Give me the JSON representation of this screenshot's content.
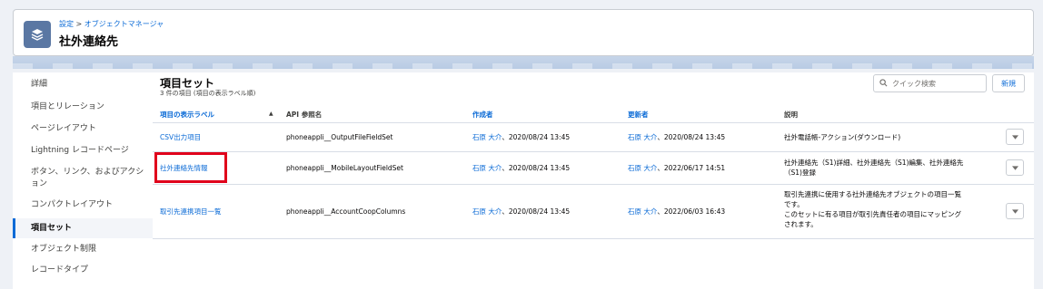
{
  "header": {
    "breadcrumb_setup": "設定",
    "breadcrumb_sep": " > ",
    "breadcrumb_object_manager": "オブジェクトマネージャ",
    "title": "社外連絡先"
  },
  "sidebar": {
    "items": [
      {
        "label": "詳細",
        "active": false
      },
      {
        "label": "項目とリレーション",
        "active": false
      },
      {
        "label": "ページレイアウト",
        "active": false
      },
      {
        "label": "Lightning レコードページ",
        "active": false
      },
      {
        "label": "ボタン、リンク、およびアクション",
        "active": false
      },
      {
        "label": "コンパクトレイアウト",
        "active": false
      },
      {
        "label": "項目セット",
        "active": true
      },
      {
        "label": "オブジェクト制限",
        "active": false
      },
      {
        "label": "レコードタイプ",
        "active": false
      }
    ]
  },
  "main": {
    "title": "項目セット",
    "subtitle": "3 件の項目 (項目の表示ラベル順)",
    "search_placeholder": "クイック検索",
    "new_label": "新規",
    "columns": [
      "項目の表示ラベル",
      "API 参照名",
      "作成者",
      "更新者",
      "説明"
    ],
    "sort_arrow": "▲",
    "rows": [
      {
        "label": "CSV出力項目",
        "api": "phoneappli__OutputFileFieldSet",
        "created_by": "石原 大介",
        "created_at": "、2020/08/24 13:45",
        "updated_by": "石原 大介",
        "updated_at": "、2020/08/24 13:45",
        "description": [
          "社外電話帳-アクション(ダウンロード)"
        ]
      },
      {
        "label": "社外連絡先情報",
        "api": "phoneappli__MobileLayoutFieldSet",
        "created_by": "石原 大介",
        "created_at": "、2020/08/24 13:45",
        "updated_by": "石原 大介",
        "updated_at": "、2022/06/17 14:51",
        "description": [
          "社外連絡先（S1)詳細、社外連絡先（S1)編集、社外連絡先",
          "（S1)登録"
        ]
      },
      {
        "label": "取引先連携項目一覧",
        "api": "phoneappli__AccountCoopColumns",
        "created_by": "石原 大介",
        "created_at": "、2020/08/24 13:45",
        "updated_by": "石原 大介",
        "updated_at": "、2022/06/03 16:43",
        "description": [
          "取引先連携に使用する社外連絡先オブジェクトの項目一覧",
          "です。",
          "このセットに有る項目が取引先責任者の項目にマッピング",
          "されます。"
        ]
      }
    ]
  },
  "colors": {
    "link": "#0a6ad6",
    "icon_bg": "#5a77a3",
    "highlight": "#e0001b",
    "active_border": "#0a6ad6"
  },
  "icons": {
    "object_icon": "layers-icon",
    "search_icon": "search-icon",
    "dropdown_icon": "chevron-down-icon"
  }
}
